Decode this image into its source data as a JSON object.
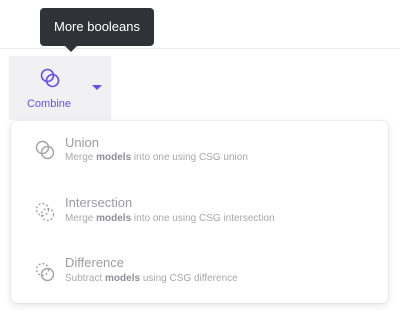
{
  "tooltip": {
    "text": "More booleans"
  },
  "toolbar": {
    "combine_label": "Combine",
    "combine_icon": "combine-icon",
    "accent_color": "#6a4cf5"
  },
  "menu": {
    "items": [
      {
        "title": "Union",
        "desc_pre": "Merge ",
        "desc_bold": "models",
        "desc_post": " into one using CSG union",
        "icon": "union-icon"
      },
      {
        "title": "Intersection",
        "desc_pre": "Merge ",
        "desc_bold": "models",
        "desc_post": " into one using CSG intersection",
        "icon": "intersection-icon"
      },
      {
        "title": "Difference",
        "desc_pre": "Subtract ",
        "desc_bold": "models",
        "desc_post": " using CSG difference",
        "icon": "difference-icon"
      }
    ]
  }
}
